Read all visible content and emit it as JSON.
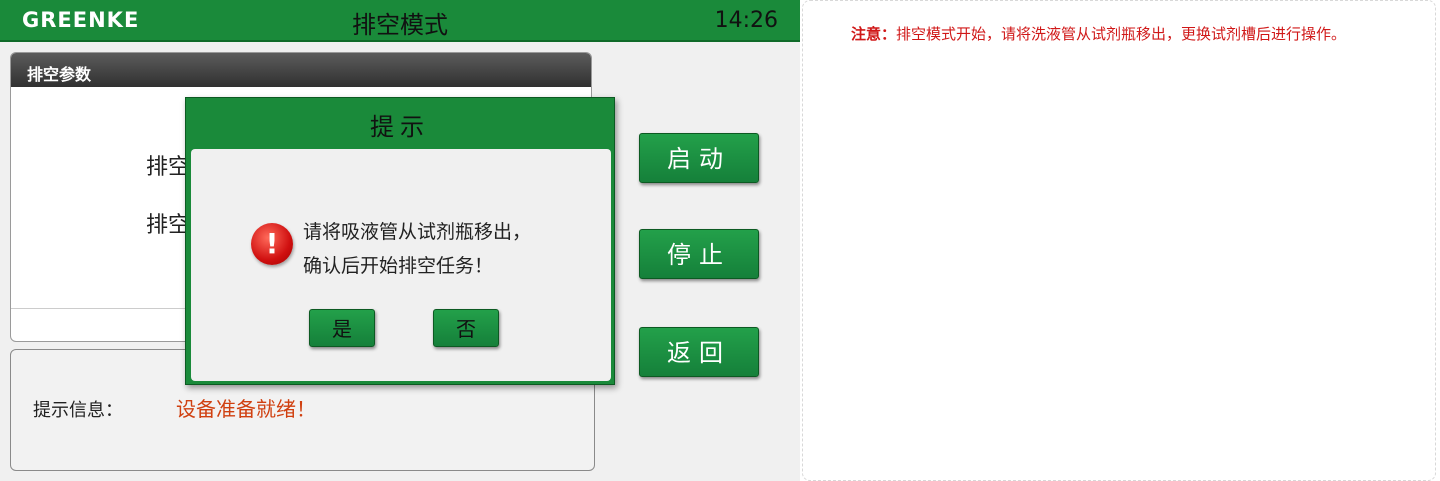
{
  "header": {
    "brand": "GREENKE",
    "title": "排空模式",
    "time": "14:26"
  },
  "params_panel": {
    "title": "排空参数",
    "labels": [
      "排空",
      "排空"
    ]
  },
  "info_panel": {
    "label": "提示信息：",
    "value": "设备准备就绪！"
  },
  "side_buttons": {
    "start": "启动",
    "stop": "停止",
    "back": "返回"
  },
  "dialog": {
    "title": "提示",
    "icon": "warning-icon",
    "messages": [
      "请将吸液管从试剂瓶移出，",
      "确认后开始排空任务！"
    ],
    "yes_label": "是",
    "no_label": "否"
  },
  "note": {
    "label": "注意：",
    "text": "排空模式开始，请将洗液管从试剂瓶移出，更换试剂槽后进行操作。"
  },
  "colors": {
    "header_green": "#1a8a3a",
    "button_green": "#15803a",
    "info_red": "#d04010",
    "note_red": "#d01818",
    "panel_header_dark": "#303030"
  }
}
